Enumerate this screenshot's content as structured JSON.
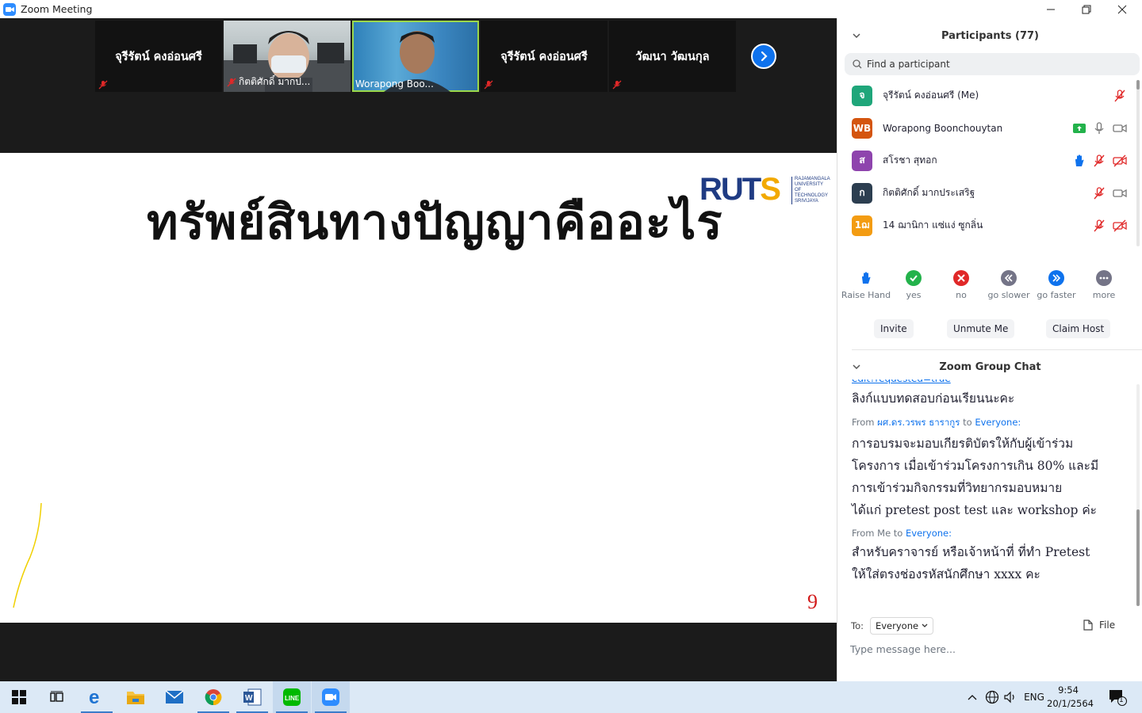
{
  "window": {
    "title": "Zoom Meeting"
  },
  "gallery": [
    {
      "name": "จุรีรัตน์ คงอ่อนศรี",
      "label": "",
      "muted": true,
      "video": false
    },
    {
      "name": "",
      "label": "กิตติศักดิ์ มากป...",
      "muted": true,
      "video": true
    },
    {
      "name": "",
      "label": "Worapong Boo...",
      "muted": false,
      "video": true,
      "active": true
    },
    {
      "name": "จุรีรัตน์ คงอ่อนศรี",
      "label": "",
      "muted": true,
      "video": false
    },
    {
      "name": "วัฒนา วัฒนกุล",
      "label": "",
      "muted": true,
      "video": false
    }
  ],
  "slide": {
    "title": "ทรัพย์สินทางปัญญาคืออะไร",
    "logo_text": "RUTS",
    "logo_sub": "RAJAMANGALA UNIVERSITY OF TECHNOLOGY SRIVIJAYA",
    "page_number": "9"
  },
  "participants": {
    "header": "Participants (77)",
    "search_placeholder": "Find a participant",
    "list": [
      {
        "initials": "จ",
        "color": "#1fa67a",
        "name": "จุรีรัตน์ คงอ่อนศรี (Me)",
        "icons": [
          "mic-muted"
        ]
      },
      {
        "initials": "WB",
        "color": "#d4550f",
        "name": "Worapong Boonchouytan",
        "icons": [
          "share-screen",
          "mic",
          "video"
        ]
      },
      {
        "initials": "ส",
        "color": "#8e44ad",
        "name": "สโรชา สุทอก",
        "icons": [
          "raise-hand",
          "mic-muted",
          "video-off"
        ]
      },
      {
        "initials": "ก",
        "color": "#2c3e50",
        "name": "กิตติศักดิ์ มากประเสริฐ",
        "icons": [
          "mic-muted",
          "video"
        ]
      },
      {
        "initials": "1ฌ",
        "color": "#f39c12",
        "name": "14 ฌานิกา แซ่แง่ ซูกลิ่น",
        "icons": [
          "mic-muted",
          "video-off"
        ]
      }
    ],
    "reactions": [
      "Raise Hand",
      "yes",
      "no",
      "go slower",
      "go faster",
      "more"
    ],
    "actions": {
      "invite": "Invite",
      "unmute": "Unmute Me",
      "claim_host": "Claim Host"
    }
  },
  "chat": {
    "header": "Zoom Group Chat",
    "link_tail": "edit?requested=true",
    "messages": [
      {
        "from": "",
        "to": "",
        "text": "ลิงก์แบบทดสอบก่อนเรียนนะคะ"
      },
      {
        "from_prefix": "From",
        "from": "ผศ.ดร.วรพร ธารากูร",
        "to_word": "to",
        "to": "Everyone:",
        "lines": [
          "การอบรมจะมอบเกียรติบัตรให้กับผู้เข้าร่วม",
          "โครงการ เมื่อเข้าร่วมโครงการเกิน 80% และมี",
          "การเข้าร่วมกิจกรรมที่วิทยากรมอบหมาย",
          "ได้แก่ pretest post test และ workshop ค่ะ"
        ]
      },
      {
        "from_prefix": "From Me to",
        "to": "Everyone:",
        "lines": [
          "สำหรับคราจารย์ หรือเจ้าหน้าที่ ที่ทำ Pretest",
          "ให้ใส่ตรงช่องรหัสนักศึกษา xxxx คะ"
        ]
      }
    ],
    "to_label": "To:",
    "to_value": "Everyone",
    "file_label": "File",
    "input_placeholder": "Type message here..."
  },
  "taskbar": {
    "language": "ENG",
    "time": "9:54",
    "date": "20/1/2564",
    "notification_count": "1"
  },
  "colors": {
    "zoom_blue": "#0e72ed",
    "active_border": "#9bd84a",
    "slide_page": "#d21b1b"
  }
}
